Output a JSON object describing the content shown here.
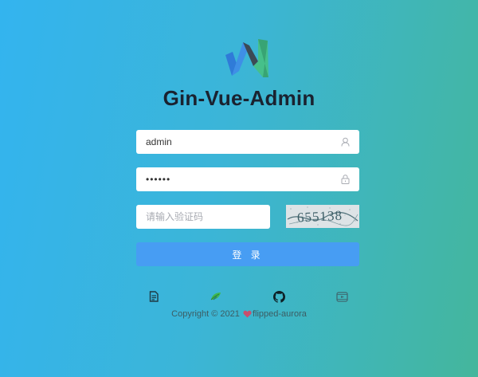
{
  "app": {
    "title": "Gin-Vue-Admin"
  },
  "form": {
    "username": {
      "value": "admin",
      "icon": "user-icon"
    },
    "password": {
      "value": "123456",
      "icon": "lock-icon"
    },
    "captcha": {
      "placeholder": "请输入验证码",
      "image_text": "655138"
    },
    "submit_label": "登 录"
  },
  "footer": {
    "links": [
      {
        "icon": "document-icon"
      },
      {
        "icon": "vue-leaf-icon"
      },
      {
        "icon": "github-icon"
      },
      {
        "icon": "video-icon"
      }
    ],
    "copyright_prefix": "Copyright © 2021",
    "author": "flipped-aurora"
  },
  "colors": {
    "background_start": "#33b4ef",
    "background_end": "#44b69c",
    "button": "#479df3",
    "title": "#1a2230"
  }
}
